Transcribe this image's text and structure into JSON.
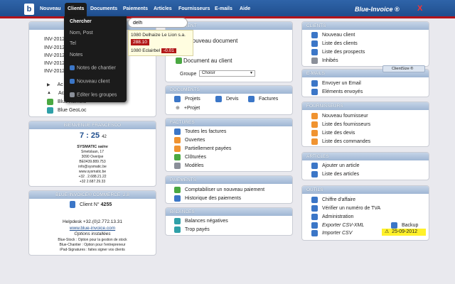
{
  "app": {
    "logo": "b",
    "brand": "Blue-Invoice ®",
    "close": "X"
  },
  "nav": [
    "Nouveau",
    "Clients",
    "Documents",
    "Paiements",
    "Articles",
    "Fournisseurs",
    "E-mails",
    "Aide"
  ],
  "dropdown": {
    "items": [
      "Chercher",
      "Nom, Post",
      "Tel",
      "Notes",
      "Notes de chantier",
      "Nouveau client",
      "Editer les groupes"
    ]
  },
  "search": {
    "value": "delh"
  },
  "search_results": [
    {
      "name": "1080 Delhaize Le Lion s.a.",
      "amount": "288.10"
    },
    {
      "name": "1080 Eclairbel",
      "amount": "-0.01"
    }
  ],
  "recent_docs": [
    "INV-2012-",
    "INV-2012-",
    "INV-2012-",
    "INV-2012-",
    "INV-2012-"
  ],
  "left_links": [
    "Ac",
    "Ac",
    "Blue Remote",
    "Blue GeoLoc"
  ],
  "welcome": {
    "title": "BIENVENUE FRANCESCO",
    "time": "7 : 25",
    "seconds": "42",
    "company": [
      "SYSMATIC sa/nv",
      "Smetslaan, 17",
      "3090 Overijse",
      "BE0439.889.753",
      "info@sysmatic.be",
      "www.sysmatic.be",
      "+32 . 2.688.21.22",
      "+32 2.687.29.33"
    ]
  },
  "commerce": {
    "title": "BLUE-INVOICE® COMMERCE",
    "version": "2.8",
    "client_label": "Client N°",
    "client_no": "4255",
    "helpdesk": "Helpdesk +32.(0)2.772.13.31",
    "website": "www.blue-invoice.com",
    "options_title": "Options installées",
    "options": [
      "Blue-Stock : Option pour la gestion de stock",
      "Blue-Chantier : Option pour l'entrepreneur",
      "iPad-Signatures : faites signer vos clients"
    ]
  },
  "doc_panel": {
    "title": "DOCUMENT",
    "new_doc": "Nouveau document",
    "doc_client": "Document au client",
    "group_label": "Groupe",
    "group_value": "Choisir"
  },
  "documents": {
    "title": "DOCUMENTS",
    "projets": "Projets",
    "devis": "Devis",
    "factures": "Factures",
    "plus_projet": "+Projet"
  },
  "factures": {
    "title": "FACTURES",
    "items": [
      "Toutes les factures",
      "Ouvertes",
      "Partiellement payées",
      "Clôturées",
      "Modèles"
    ]
  },
  "paiements": {
    "title": "PAIEMENTS",
    "items": [
      "Comptabiliser un nouveau paiement",
      "Historique des paiements"
    ]
  },
  "balances": {
    "title": "BALANCES",
    "items": [
      "Balances négatives",
      "Trop payés"
    ]
  },
  "clients": {
    "title": "CLIENTS",
    "items": [
      "Nouveau client",
      "Liste des clients",
      "Liste des prospects",
      "Inhibés"
    ]
  },
  "emails": {
    "title": "E-MAILS",
    "items": [
      "Envoyer un Email",
      "Eléments envoyés"
    ],
    "clientsize": "ClientSize ®"
  },
  "fournisseurs": {
    "title": "FOURNISSEURS",
    "items": [
      "Nouveau fournisseur",
      "Liste des fournisseurs",
      "Liste des devis",
      "Liste des commandes"
    ]
  },
  "articles": {
    "title": "ARTICLES",
    "items": [
      "Ajouter un article",
      "Liste des articles"
    ]
  },
  "outils": {
    "title": "OUTILS",
    "items": [
      "Chiffre d'affaire",
      "Vérifier un numéro de TVA",
      "Administration",
      "Exporter CSV-XML",
      "Importer CSV"
    ],
    "backup": "Backup",
    "backup_date": "25-09-2012"
  }
}
